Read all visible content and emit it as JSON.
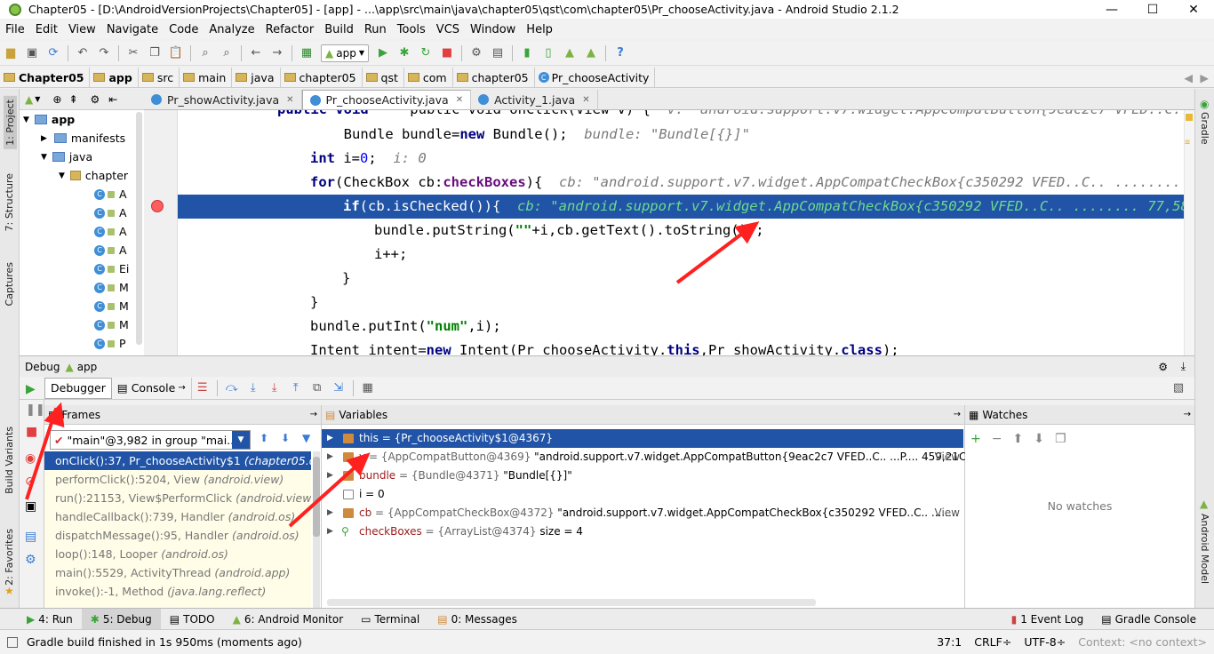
{
  "window": {
    "title": "Chapter05 - [D:\\AndroidVersionProjects\\Chapter05] - [app] - ...\\app\\src\\main\\java\\chapter05\\qst\\com\\chapter05\\Pr_chooseActivity.java - Android Studio 2.1.2",
    "minimize": "—",
    "maximize": "☐",
    "close": "✕"
  },
  "menu": [
    "File",
    "Edit",
    "View",
    "Navigate",
    "Code",
    "Analyze",
    "Refactor",
    "Build",
    "Run",
    "Tools",
    "VCS",
    "Window",
    "Help"
  ],
  "toolbar": {
    "run_config": "app"
  },
  "breadcrumbs": [
    "Chapter05",
    "app",
    "src",
    "main",
    "java",
    "chapter05",
    "qst",
    "com",
    "chapter05",
    "Pr_chooseActivity"
  ],
  "left_strip": {
    "project": "1: Project",
    "structure": "7: Structure",
    "captures": "Captures",
    "build_variants": "Build Variants",
    "favorites": "2: Favorites"
  },
  "right_strip": {
    "gradle": "Gradle",
    "android_model": "Android Model"
  },
  "project_tree": [
    {
      "label": "app",
      "level": 0,
      "kind": "folder"
    },
    {
      "label": "manifests",
      "level": 1,
      "kind": "folder"
    },
    {
      "label": "java",
      "level": 1,
      "kind": "folder"
    },
    {
      "label": "chapter",
      "level": 2,
      "kind": "package"
    },
    {
      "label": "A",
      "level": 3,
      "kind": "class"
    },
    {
      "label": "A",
      "level": 3,
      "kind": "class"
    },
    {
      "label": "A",
      "level": 3,
      "kind": "class"
    },
    {
      "label": "A",
      "level": 3,
      "kind": "class"
    },
    {
      "label": "Ei",
      "level": 3,
      "kind": "class"
    },
    {
      "label": "M",
      "level": 3,
      "kind": "class"
    },
    {
      "label": "M",
      "level": 3,
      "kind": "class"
    },
    {
      "label": "M",
      "level": 3,
      "kind": "class"
    },
    {
      "label": "P",
      "level": 3,
      "kind": "class"
    }
  ],
  "editor_tabs": [
    {
      "label": "Pr_showActivity.java",
      "active": false
    },
    {
      "label": "Pr_chooseActivity.java",
      "active": true
    },
    {
      "label": "Activity_1.java",
      "active": false
    }
  ],
  "code": {
    "l0a": "    public void onClick(View v) {  ",
    "l0b": "v: \"android.support.v7.widget.AppCompatButton{9eac2c7 VFED..C.. ...P.... 459,210",
    "l1a": "        Bundle bundle=",
    "l1kw": "new",
    "l1b": " Bundle();  ",
    "l1h": "bundle: \"Bundle[{}]\"",
    "l2kw": "int",
    "l2a": " i=",
    "l2n": "0",
    "l2b": ";  ",
    "l2h": "i: 0",
    "l3kw": "for",
    "l3a": "(CheckBox cb:",
    "l3b": "checkBoxes",
    "l3c": "){  ",
    "l3h": "cb: \"android.support.v7.widget.AppCompatCheckBox{c350292 VFED..C.. ........ 77,",
    "l4kw": "if",
    "l4a": "(cb.isChecked()){  ",
    "l4h": "cb: \"android.support.v7.widget.AppCompatCheckBox{c350292 VFED..C.. ........ 77,58-947",
    "l5a": "bundle.putString(",
    "l5s": "\"\"",
    "l5b": "+i,cb.getText().toString());",
    "l6a": "i++;",
    "l7a": "}",
    "l8a": "}",
    "l9a": "bundle.putInt(",
    "l9s": "\"num\"",
    "l9b": ",i);",
    "l10a": "Intent intent=",
    "l10kw": "new",
    "l10b": " Intent(Pr_chooseActivity.",
    "l10kw2": "this",
    "l10c": ",Pr_showActivity.",
    "l10kw3": "class",
    "l10d": ");"
  },
  "debug": {
    "header_label": "Debug",
    "config": "app",
    "tab_debugger": "Debugger",
    "tab_console": "Console"
  },
  "frames": {
    "title": "Frames",
    "thread": "\"main\"@3,982 in group \"mai...",
    "items": [
      {
        "method": "onClick():37, Pr_chooseActivity$1",
        "pkg": "(chapter05.qst.co",
        "selected": true
      },
      {
        "method": "performClick():5204, View",
        "pkg": "(android.view)",
        "selected": false
      },
      {
        "method": "run():21153, View$PerformClick",
        "pkg": "(android.view)",
        "selected": false
      },
      {
        "method": "handleCallback():739, Handler",
        "pkg": "(android.os)",
        "selected": false
      },
      {
        "method": "dispatchMessage():95, Handler",
        "pkg": "(android.os)",
        "selected": false
      },
      {
        "method": "loop():148, Looper",
        "pkg": "(android.os)",
        "selected": false
      },
      {
        "method": "main():5529, ActivityThread",
        "pkg": "(android.app)",
        "selected": false
      },
      {
        "method": "invoke():-1, Method",
        "pkg": "(java.lang.reflect)",
        "selected": false
      }
    ]
  },
  "variables": {
    "title": "Variables",
    "items": [
      {
        "name": "this",
        "type": "= {Pr_chooseActivity$1@4367}",
        "value": "",
        "view": "",
        "selected": true
      },
      {
        "name": "v",
        "type": "= {AppCompatButton@4369}",
        "value": " \"android.support.v7.widget.AppCompatButton{9eac2c7 VFED..C.. ...P.... 459,21C...",
        "view": "View",
        "selected": false
      },
      {
        "name": "bundle",
        "type": "= {Bundle@4371}",
        "value": " \"Bundle[{}]\"",
        "view": "",
        "selected": false
      },
      {
        "name": "i = 0",
        "type": "",
        "value": "",
        "view": "",
        "selected": false
      },
      {
        "name": "cb",
        "type": "= {AppCompatCheckBox@4372}",
        "value": " \"android.support.v7.widget.AppCompatCheckBox{c350292 VFED..C.. ........",
        "view": "View",
        "selected": false
      },
      {
        "name": "checkBoxes",
        "type": "= {ArrayList@4374}",
        "value": "  size = 4",
        "view": "",
        "selected": false
      }
    ]
  },
  "watches": {
    "title": "Watches",
    "empty": "No watches"
  },
  "bottom_tabs": [
    {
      "label": "4: Run"
    },
    {
      "label": "5: Debug"
    },
    {
      "label": "TODO"
    },
    {
      "label": "6: Android Monitor"
    },
    {
      "label": "Terminal"
    },
    {
      "label": "0: Messages"
    }
  ],
  "bottom_right_tabs": [
    {
      "label": "1 Event Log"
    },
    {
      "label": "Gradle Console"
    }
  ],
  "status": {
    "message": "Gradle build finished in 1s 950ms (moments ago)",
    "position": "37:1",
    "line_sep": "CRLF÷",
    "encoding": "UTF-8÷",
    "context": "Context: <no context>"
  },
  "colors": {
    "selection": "#2154a6",
    "annotation_arrow": "#ff2020",
    "frames_bg": "#fffde7"
  }
}
